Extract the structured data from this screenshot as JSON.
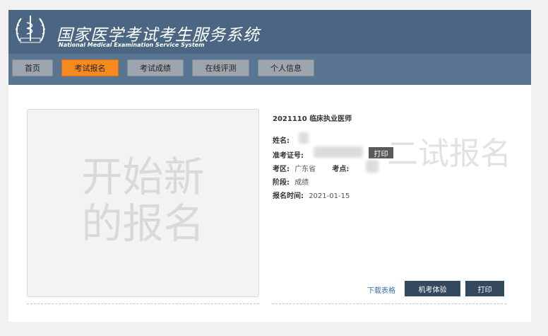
{
  "header": {
    "title_cn": "国家医学考试考生服务系统",
    "title_en": "National Medical Examination Service System",
    "logo_icon": "medical-emblem-icon"
  },
  "nav": {
    "items": [
      {
        "label": "首页",
        "active": false
      },
      {
        "label": "考试报名",
        "active": true
      },
      {
        "label": "考试成绩",
        "active": false
      },
      {
        "label": "在线评测",
        "active": false
      },
      {
        "label": "个人信息",
        "active": false
      }
    ]
  },
  "new_registration": {
    "line1": "开始新",
    "line2": "的报名"
  },
  "registration": {
    "exam_title": "2021110 临床执业医师",
    "name_label": "姓名:",
    "admission_label": "准考证号:",
    "print_small": "打印",
    "district_label": "考区:",
    "district_value": "广东省",
    "site_label": "考点:",
    "stage_label": "阶段:",
    "stage_value": "成绩",
    "time_label": "报名时间:",
    "time_value": "2021-01-15",
    "watermark": "二试报名",
    "download_label": "下载表格",
    "machine_test_label": "机考体验",
    "print_label": "打印"
  },
  "colors": {
    "header_bg": "#4a6682",
    "nav_active": "#f58a1f",
    "button_dark": "#35495e"
  }
}
